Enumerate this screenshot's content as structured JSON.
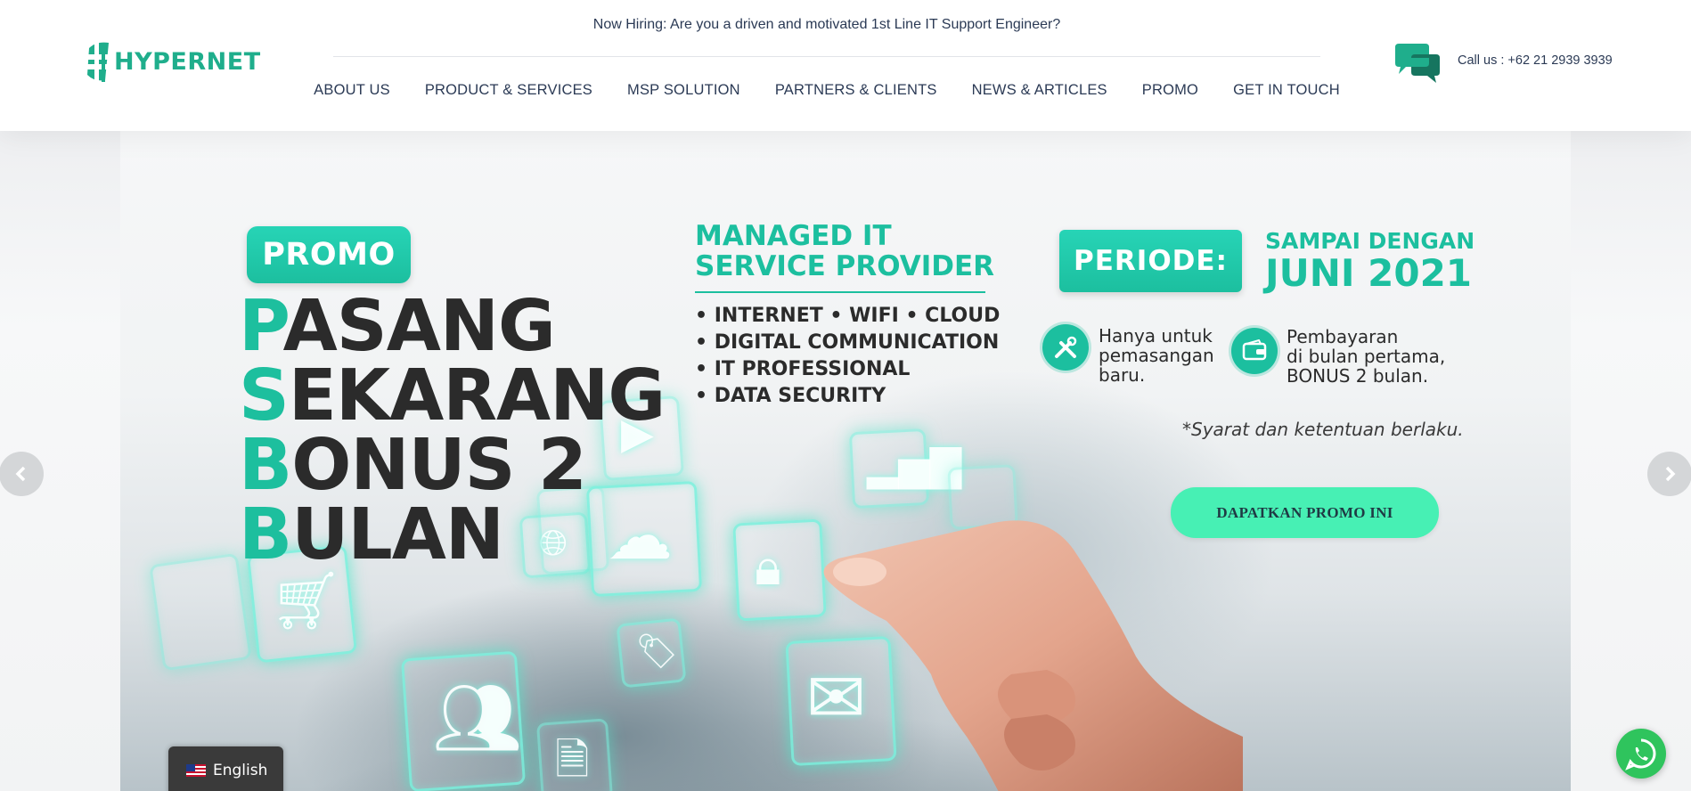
{
  "header": {
    "logo_text": "HYPERNET",
    "hiring_text": "Now Hiring: Are you a driven and motivated 1st Line IT Support Engineer?",
    "nav": [
      "ABOUT US",
      "PRODUCT & SERVICES",
      "MSP SOLUTION",
      "PARTNERS & CLIENTS",
      "NEWS & ARTICLES",
      "PROMO",
      "GET IN TOUCH"
    ],
    "call_text": "Call us : +62 21 2939 3939",
    "chat_icon": "chat-bubbles-icon"
  },
  "banner": {
    "promo_badge": "PROMO",
    "headline": [
      {
        "first": "P",
        "rest": "ASANG"
      },
      {
        "first": "S",
        "rest": "EKARANG"
      },
      {
        "first": "B",
        "rest": "ONUS 2"
      },
      {
        "first": "B",
        "rest": "ULAN"
      }
    ],
    "msp_title_line1": "MANAGED IT",
    "msp_title_line2": "SERVICE PROVIDER",
    "msp_list": [
      "• INTERNET • WIFI • CLOUD",
      "• DIGITAL COMMUNICATION",
      "• IT PROFESSIONAL",
      "• DATA SECURITY"
    ],
    "periode_label": "PERIODE:",
    "sampai_text": "SAMPAI DENGAN",
    "juni_text": "JUNI 2021",
    "feature_1": [
      "Hanya untuk",
      "pemasangan",
      "baru."
    ],
    "feature_2": [
      "Pembayaran",
      "di bulan pertama,",
      "BONUS 2 bulan."
    ],
    "syarat": "*Syarat dan ketentuan berlaku.",
    "cta_label": "DAPATKAN PROMO INI"
  },
  "language": {
    "label": "English",
    "flag": "us-flag-icon"
  },
  "colors": {
    "brand_teal": "#1cbf9f",
    "cta_green": "#47f0b4",
    "nav_text": "#2b3a55",
    "whatsapp": "#2fc45d"
  }
}
